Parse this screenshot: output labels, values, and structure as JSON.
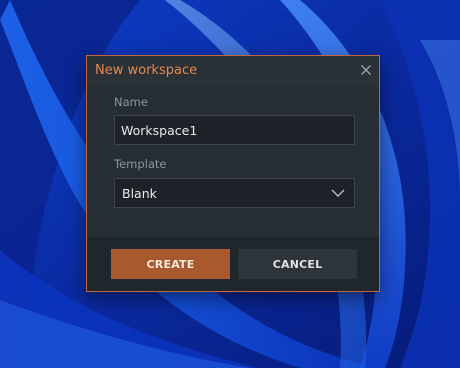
{
  "dialog": {
    "title": "New workspace",
    "name_label": "Name",
    "name_value": "Workspace1",
    "template_label": "Template",
    "template_value": "Blank",
    "create_label": "CREATE",
    "cancel_label": "CANCEL"
  },
  "icons": {
    "close": "close-icon",
    "dropdown": "chevron-down-icon"
  },
  "colors": {
    "accent": "#e3884f",
    "border": "#c0673a",
    "primary_button": "#a85a2e",
    "dialog_bg": "#262d33",
    "wallpaper": "#0a2fa8"
  }
}
